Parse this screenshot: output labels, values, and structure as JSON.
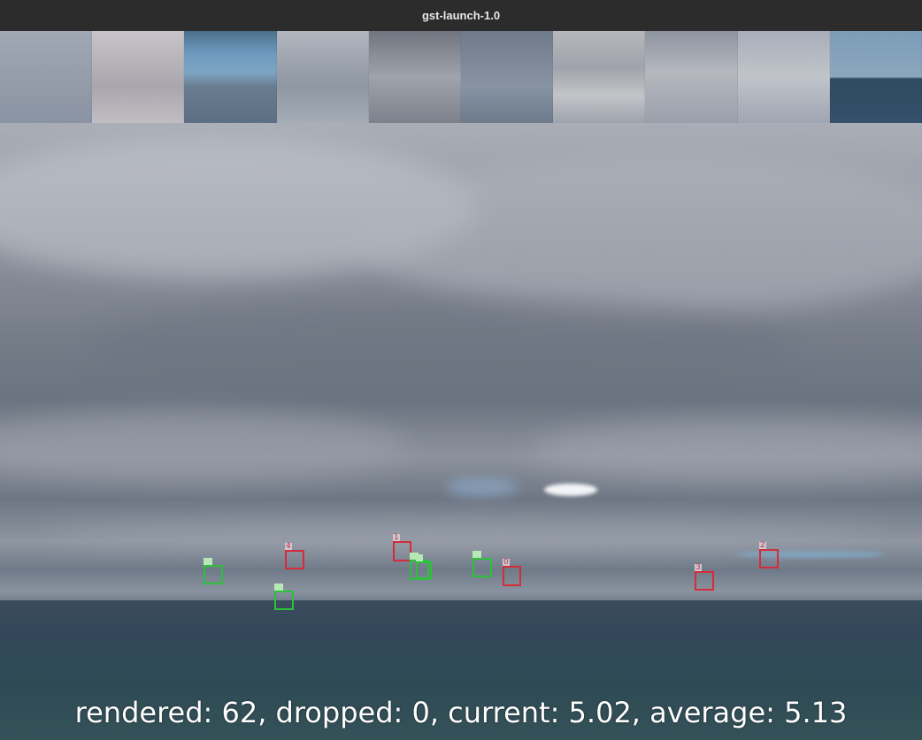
{
  "window": {
    "title": "gst-launch-1.0"
  },
  "stats": {
    "text": "rendered: 62, dropped: 0, current: 5.02, average: 5.13"
  },
  "thumbnails": [
    {
      "name": "thumb-1",
      "color": "#8e97a6"
    },
    {
      "name": "thumb-2",
      "color": "#b6b3b8"
    },
    {
      "name": "thumb-3",
      "color": "#5f85a6"
    },
    {
      "name": "thumb-4",
      "color": "#9aa1ad"
    },
    {
      "name": "thumb-5",
      "color": "#8a8f99"
    },
    {
      "name": "thumb-6",
      "color": "#7a8595"
    },
    {
      "name": "thumb-7",
      "color": "#aeb0b6"
    },
    {
      "name": "thumb-8",
      "color": "#9ea4ae"
    },
    {
      "name": "thumb-9",
      "color": "#a6adb8"
    },
    {
      "name": "thumb-10",
      "color": "#6e8da6"
    }
  ],
  "detections": [
    {
      "label": "4",
      "kind": "red"
    },
    {
      "label": "1",
      "kind": "red"
    },
    {
      "label": "0",
      "kind": "red"
    },
    {
      "label": "2",
      "kind": "red"
    },
    {
      "label": "3",
      "kind": "red"
    },
    {
      "label": "",
      "kind": "green"
    },
    {
      "label": "",
      "kind": "green"
    },
    {
      "label": "",
      "kind": "green"
    },
    {
      "label": "",
      "kind": "green"
    },
    {
      "label": "",
      "kind": "green"
    }
  ]
}
